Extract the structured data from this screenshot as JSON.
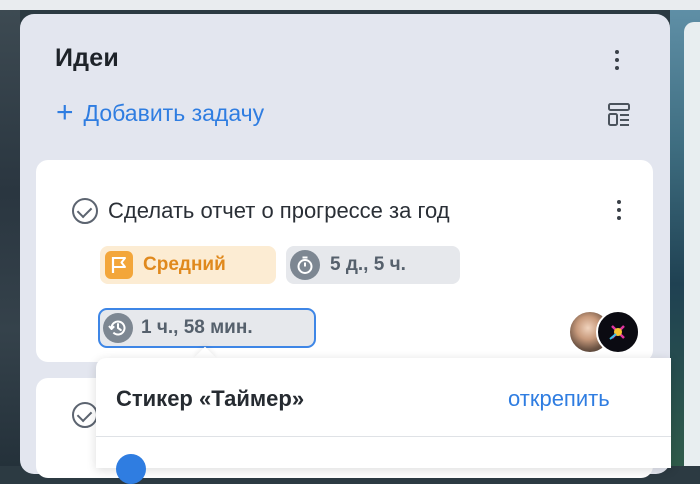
{
  "column": {
    "title": "Идеи",
    "add_task_label": "Добавить задачу"
  },
  "card": {
    "title": "Сделать отчет о прогрессе за год",
    "priority_label": "Средний",
    "estimate_label": "5 д., 5 ч.",
    "timer_label": "1 ч., 58 мин."
  },
  "popover": {
    "title": "Стикер «Таймер»",
    "action_label": "открепить"
  },
  "colors": {
    "accent": "#2f7de1",
    "priority": "#f3a63a",
    "priority_bg": "#fcecd3",
    "column_bg": "#e3e6ef"
  },
  "icons": [
    "plus-icon",
    "kebab-menu-icon",
    "board-view-icon",
    "checkmark-circle-icon",
    "flag-icon",
    "stopwatch-icon",
    "history-clock-icon"
  ]
}
